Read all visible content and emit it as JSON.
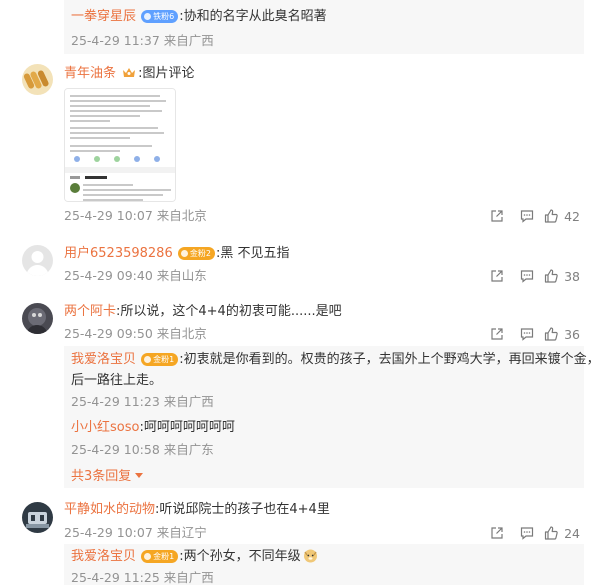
{
  "colors": {
    "username": "#eb7340",
    "meta": "#939393",
    "reply_bg": "#f7f7f7"
  },
  "top_reply": {
    "user": "一拳穿星辰",
    "badge": "铁粉6",
    "text": ":协和的名字从此臭名昭著",
    "meta": "25-4-29 11:37 来自广西"
  },
  "comments": [
    {
      "user": "青年油条",
      "badge_icon": "crown-icon",
      "text": ":图片评论",
      "meta": "25-4-29 10:07 来自北京",
      "likes": "42",
      "image_text": {
        "lines": [
          "...",
          "评论 129"
        ]
      }
    },
    {
      "user": "用户6523598286",
      "badge": "金粉2",
      "text": ":黑 不见五指",
      "meta": "25-4-29 09:40 来自山东",
      "likes": "38"
    },
    {
      "user": "两个阿卡",
      "text": ":所以说，这个4+4的初衷可能......是吧",
      "meta": "25-4-29 09:50 来自北京",
      "likes": "36",
      "replies": [
        {
          "user": "我爱洛宝贝",
          "badge": "金粉1",
          "text": ":初衷就是你看到的。权贵的孩子，去国外上个野鸡大学，再回来镀个金，然",
          "text2": "后一路往上走。",
          "meta": "25-4-29 11:23 来自广西"
        },
        {
          "user": "小小红soso",
          "text": ":呵呵呵呵呵呵呵",
          "meta": "25-4-29 10:58 来自广东"
        }
      ],
      "more_label": "共3条回复"
    },
    {
      "user": "平静如水的动物",
      "text": ":听说邱院士的孩子也在4+4里",
      "meta": "25-4-29 10:07 来自辽宁",
      "likes": "24",
      "replies": [
        {
          "user": "我爱洛宝贝",
          "badge": "金粉1",
          "text": ":两个孙女，不同年级",
          "emoji": "doge-emoji",
          "meta": "25-4-29 11:25 来自广西"
        }
      ]
    }
  ]
}
